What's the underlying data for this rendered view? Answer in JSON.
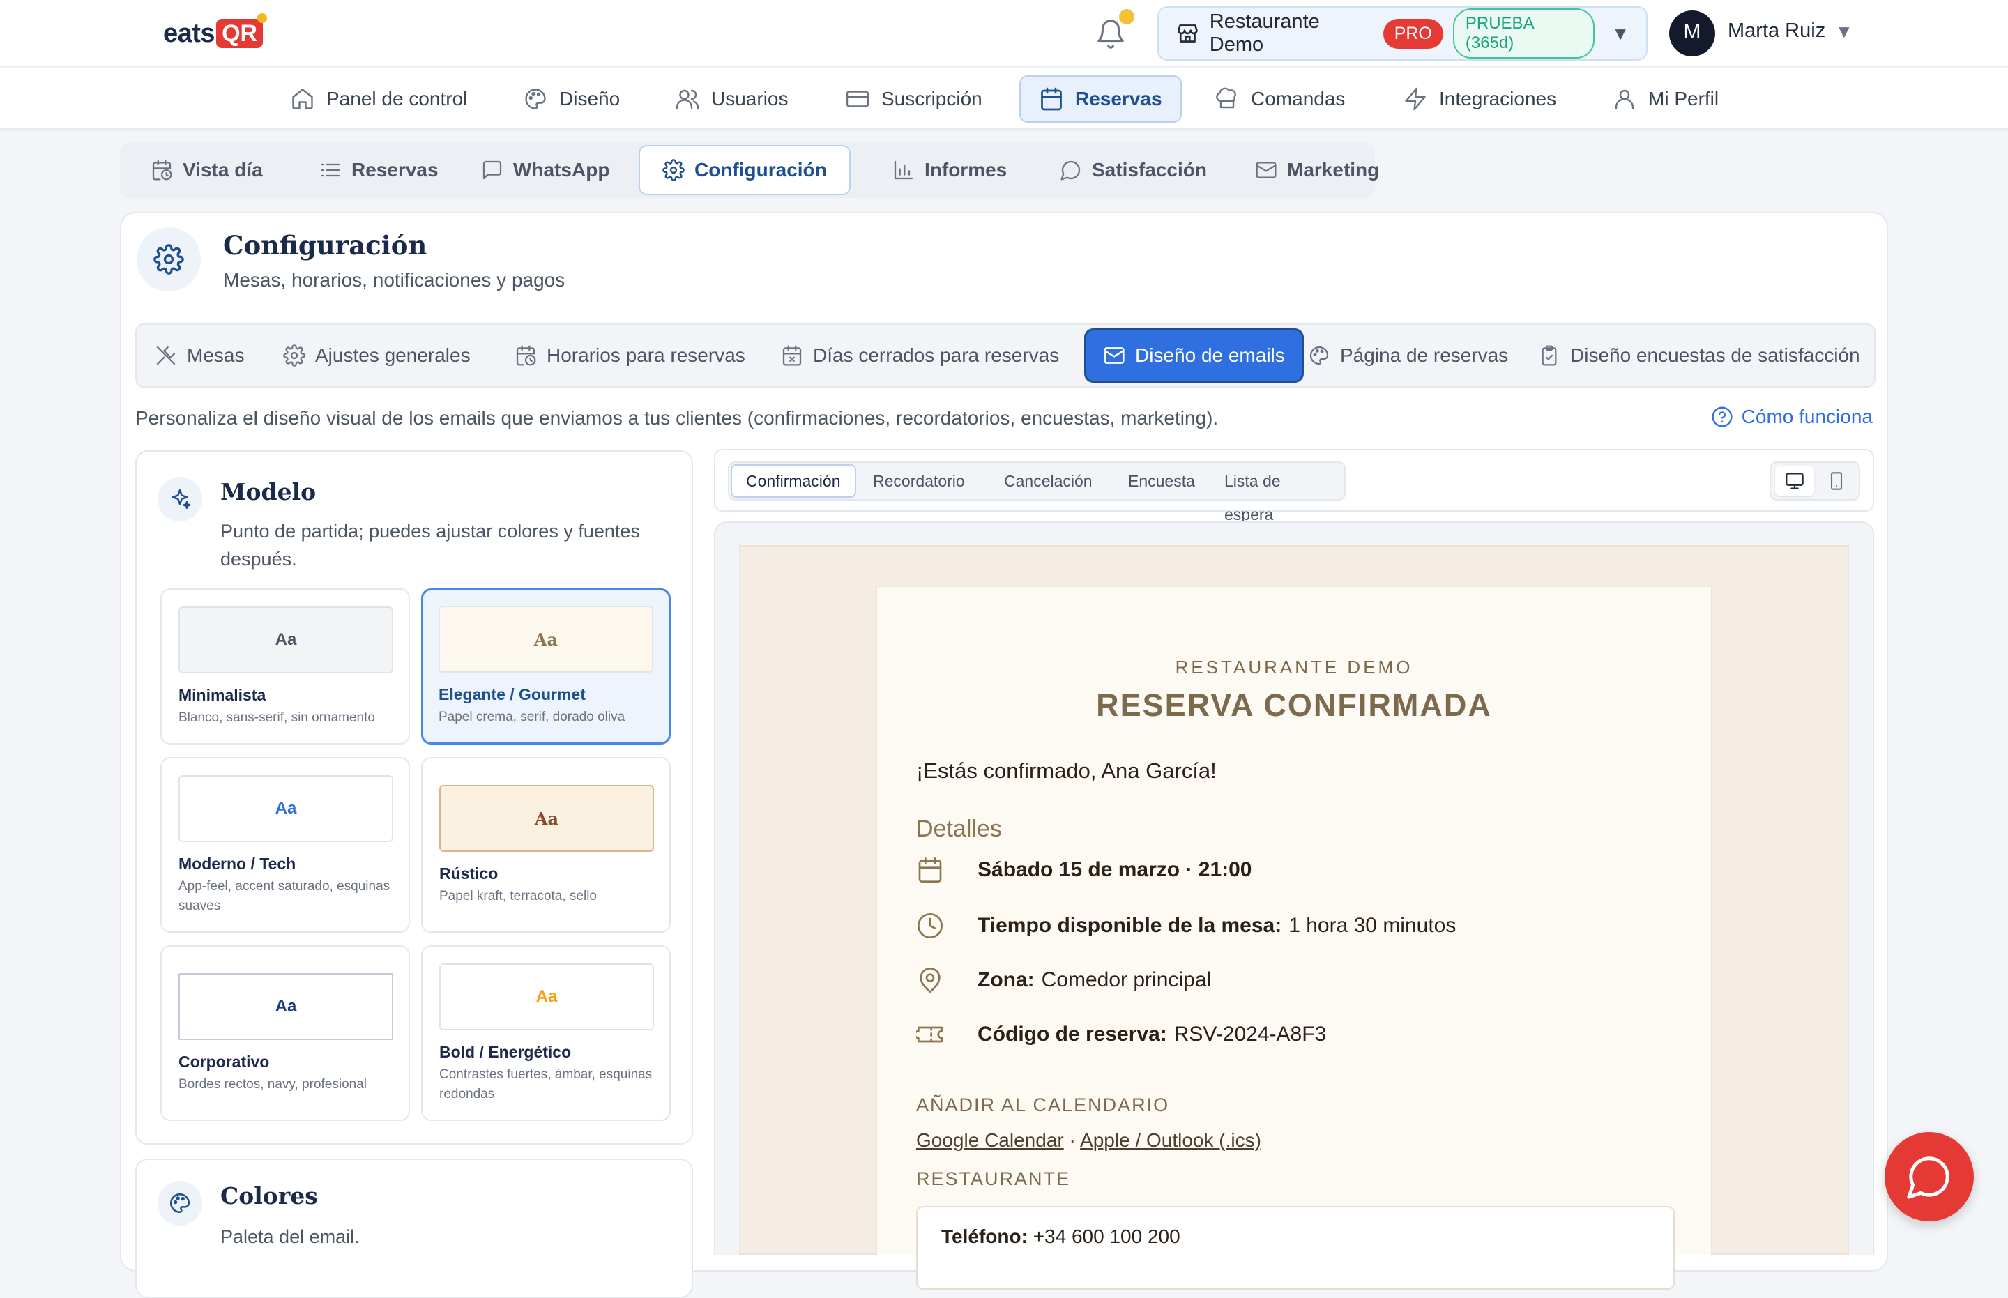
{
  "brand": {
    "logo_text": "eats",
    "logo_badge": "QR"
  },
  "header": {
    "restaurant": "Restaurante Demo",
    "plan_badge": "PRO",
    "trial_badge": "PRUEBA (365d)",
    "avatar_letter": "M",
    "user_name": "Marta Ruiz"
  },
  "main_nav": [
    {
      "label": "Panel de control",
      "icon": "home-icon"
    },
    {
      "label": "Diseño",
      "icon": "palette-icon"
    },
    {
      "label": "Usuarios",
      "icon": "users-icon"
    },
    {
      "label": "Suscripción",
      "icon": "credit-card-icon"
    },
    {
      "label": "Reservas",
      "icon": "calendar-icon",
      "active": true
    },
    {
      "label": "Comandas",
      "icon": "chef-hat-icon"
    },
    {
      "label": "Integraciones",
      "icon": "lightning-icon"
    },
    {
      "label": "Mi Perfil",
      "icon": "user-icon"
    }
  ],
  "sub_nav": [
    {
      "label": "Vista día",
      "icon": "calendar-clock-icon"
    },
    {
      "label": "Reservas",
      "icon": "list-icon"
    },
    {
      "label": "WhatsApp",
      "icon": "message-square-icon"
    },
    {
      "label": "Configuración",
      "icon": "gear-icon",
      "active": true
    },
    {
      "label": "Informes",
      "icon": "bar-chart-icon"
    },
    {
      "label": "Satisfacción",
      "icon": "chat-bubble-icon"
    },
    {
      "label": "Marketing",
      "icon": "mail-icon"
    }
  ],
  "config": {
    "title": "Configuración",
    "subtitle": "Mesas, horarios, notificaciones y pagos",
    "tabs": [
      {
        "label": "Mesas",
        "icon": "utensils-icon"
      },
      {
        "label": "Ajustes generales",
        "icon": "gear-icon"
      },
      {
        "label": "Horarios para reservas",
        "icon": "calendar-clock-icon"
      },
      {
        "label": "Días cerrados para reservas",
        "icon": "calendar-x-icon"
      },
      {
        "label": "Diseño de emails",
        "icon": "mail-icon",
        "active": true
      },
      {
        "label": "Página de reservas",
        "icon": "palette-icon"
      },
      {
        "label": "Diseño encuestas de satisfacción",
        "icon": "clipboard-check-icon"
      }
    ],
    "description": "Personaliza el diseño visual de los emails que enviamos a tus clientes (confirmaciones, recordatorios, encuestas, marketing).",
    "how_it_works": "Cómo funciona"
  },
  "model": {
    "title": "Modelo",
    "subtitle": "Punto de partida; puedes ajustar colores y fuentes después.",
    "templates": [
      {
        "preview": "Aa",
        "name": "Minimalista",
        "desc": "Blanco, sans-serif, sin ornamento",
        "preview_bg": "#f3f4f6",
        "preview_color": "#4b5563"
      },
      {
        "preview": "Aa",
        "name": "Elegante / Gourmet",
        "desc": "Papel crema, serif, dorado oliva",
        "preview_bg": "#fdf8ee",
        "preview_color": "#8a7650",
        "selected": true
      },
      {
        "preview": "Aa",
        "name": "Moderno / Tech",
        "desc": "App-feel, accent saturado, esquinas suaves",
        "preview_bg": "#ffffff",
        "preview_color": "#2f6fe0"
      },
      {
        "preview": "Aa",
        "name": "Rústico",
        "desc": "Papel kraft, terracota, sello",
        "preview_bg": "#fbf1e0",
        "preview_color": "#8b4a2b"
      },
      {
        "preview": "Aa",
        "name": "Corporativo",
        "desc": "Bordes rectos, navy, profesional",
        "preview_bg": "#ffffff",
        "preview_color": "#1b3a7a"
      },
      {
        "preview": "Aa",
        "name": "Bold / Energético",
        "desc": "Contrastes fuertes, ámbar, esquinas redondas",
        "preview_bg": "#ffffff",
        "preview_color": "#f5a00c"
      }
    ]
  },
  "colors": {
    "title": "Colores",
    "subtitle": "Paleta del email."
  },
  "preview": {
    "tabs": [
      "Confirmación",
      "Recordatorio",
      "Cancelación",
      "Encuesta",
      "Lista de espera"
    ],
    "active_tab": "Confirmación",
    "device": "desktop"
  },
  "email": {
    "restaurant": "RESTAURANTE DEMO",
    "title": "RESERVA CONFIRMADA",
    "greeting": "¡Estás confirmado, Ana García!",
    "details_heading": "Detalles",
    "date": "Sábado 15 de marzo · 21:00",
    "time_label": "Tiempo disponible de la mesa:",
    "time_value": "1 hora 30 minutos",
    "zone_label": "Zona:",
    "zone_value": "Comedor principal",
    "code_label": "Código de reserva:",
    "code_value": "RSV-2024-A8F3",
    "calendar_heading": "AÑADIR AL CALENDARIO",
    "google_link": "Google Calendar",
    "separator": "·",
    "apple_link": "Apple / Outlook (.ics)",
    "restaurant_heading": "RESTAURANTE",
    "phone_label": "Teléfono:",
    "phone_value": "+34 600 100 200"
  },
  "theme": {
    "accent": "#2f6fe0",
    "brand_red": "#e53935",
    "navy": "#1b2a4a",
    "gold": "#7c6a4d"
  }
}
